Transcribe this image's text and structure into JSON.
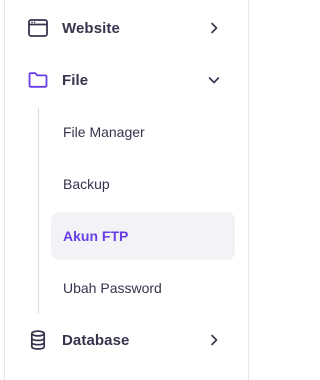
{
  "colors": {
    "accent": "#673de6",
    "text": "#36344d",
    "active_bg": "#f2f3f6",
    "tree_line": "#dadce0"
  },
  "nav": {
    "website": {
      "label": "Website",
      "icon": "browser-window-icon",
      "chevron": "chevron-right-icon"
    },
    "file": {
      "label": "File",
      "icon": "folder-icon",
      "chevron": "chevron-down-icon",
      "expanded": true,
      "children": [
        {
          "label": "File Manager",
          "active": false
        },
        {
          "label": "Backup",
          "active": false
        },
        {
          "label": "Akun FTP",
          "active": true
        },
        {
          "label": "Ubah Password",
          "active": false
        }
      ]
    },
    "database": {
      "label": "Database",
      "icon": "database-icon",
      "chevron": "chevron-right-icon"
    }
  }
}
